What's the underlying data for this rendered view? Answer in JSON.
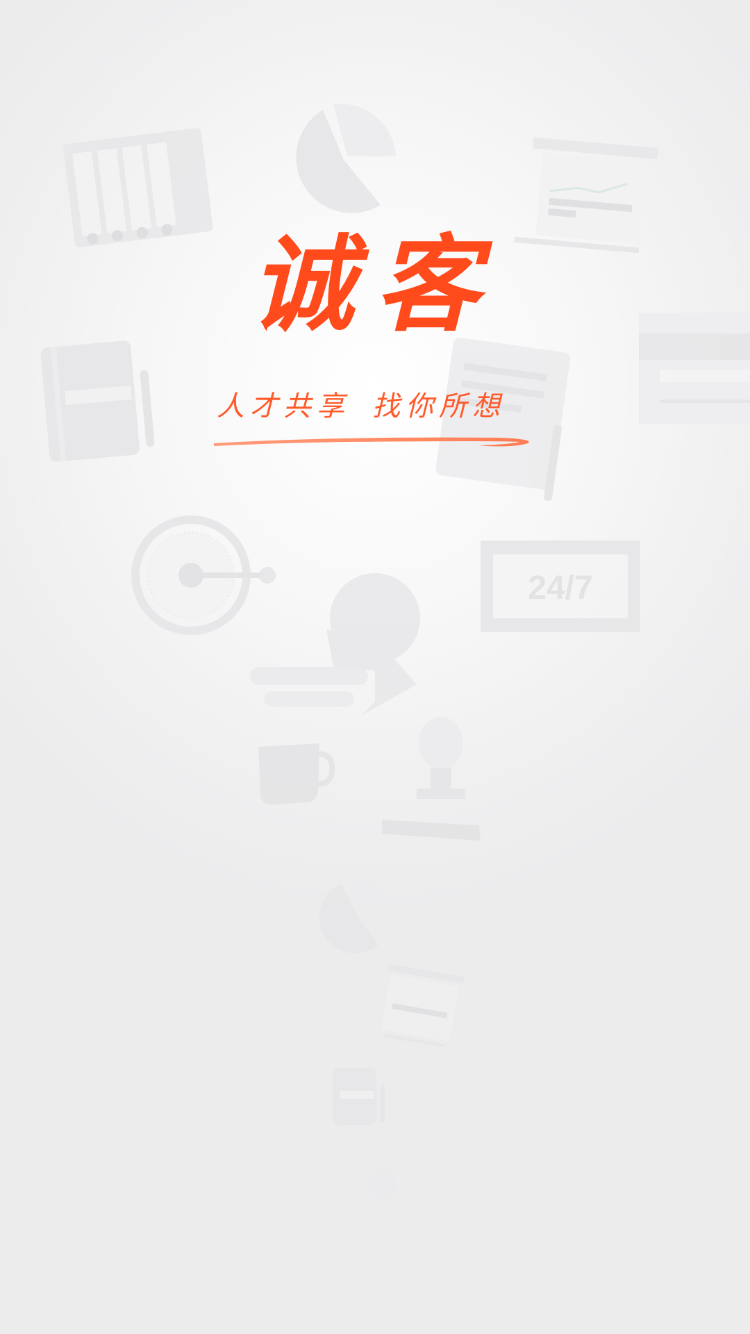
{
  "brand": {
    "title": "诚客",
    "slogan_part1": "人才共享",
    "slogan_part2": "找你所想",
    "accent_color": "#ff4a1c"
  },
  "background": {
    "clock_badge_text": "24/7",
    "icons": [
      "binder-icon",
      "pie-chart-icon",
      "report-icon",
      "notebook-icon",
      "document-icon",
      "card-icon",
      "stopwatch-icon",
      "head-icon",
      "coffee-cup-icon",
      "lightbulb-icon"
    ]
  }
}
